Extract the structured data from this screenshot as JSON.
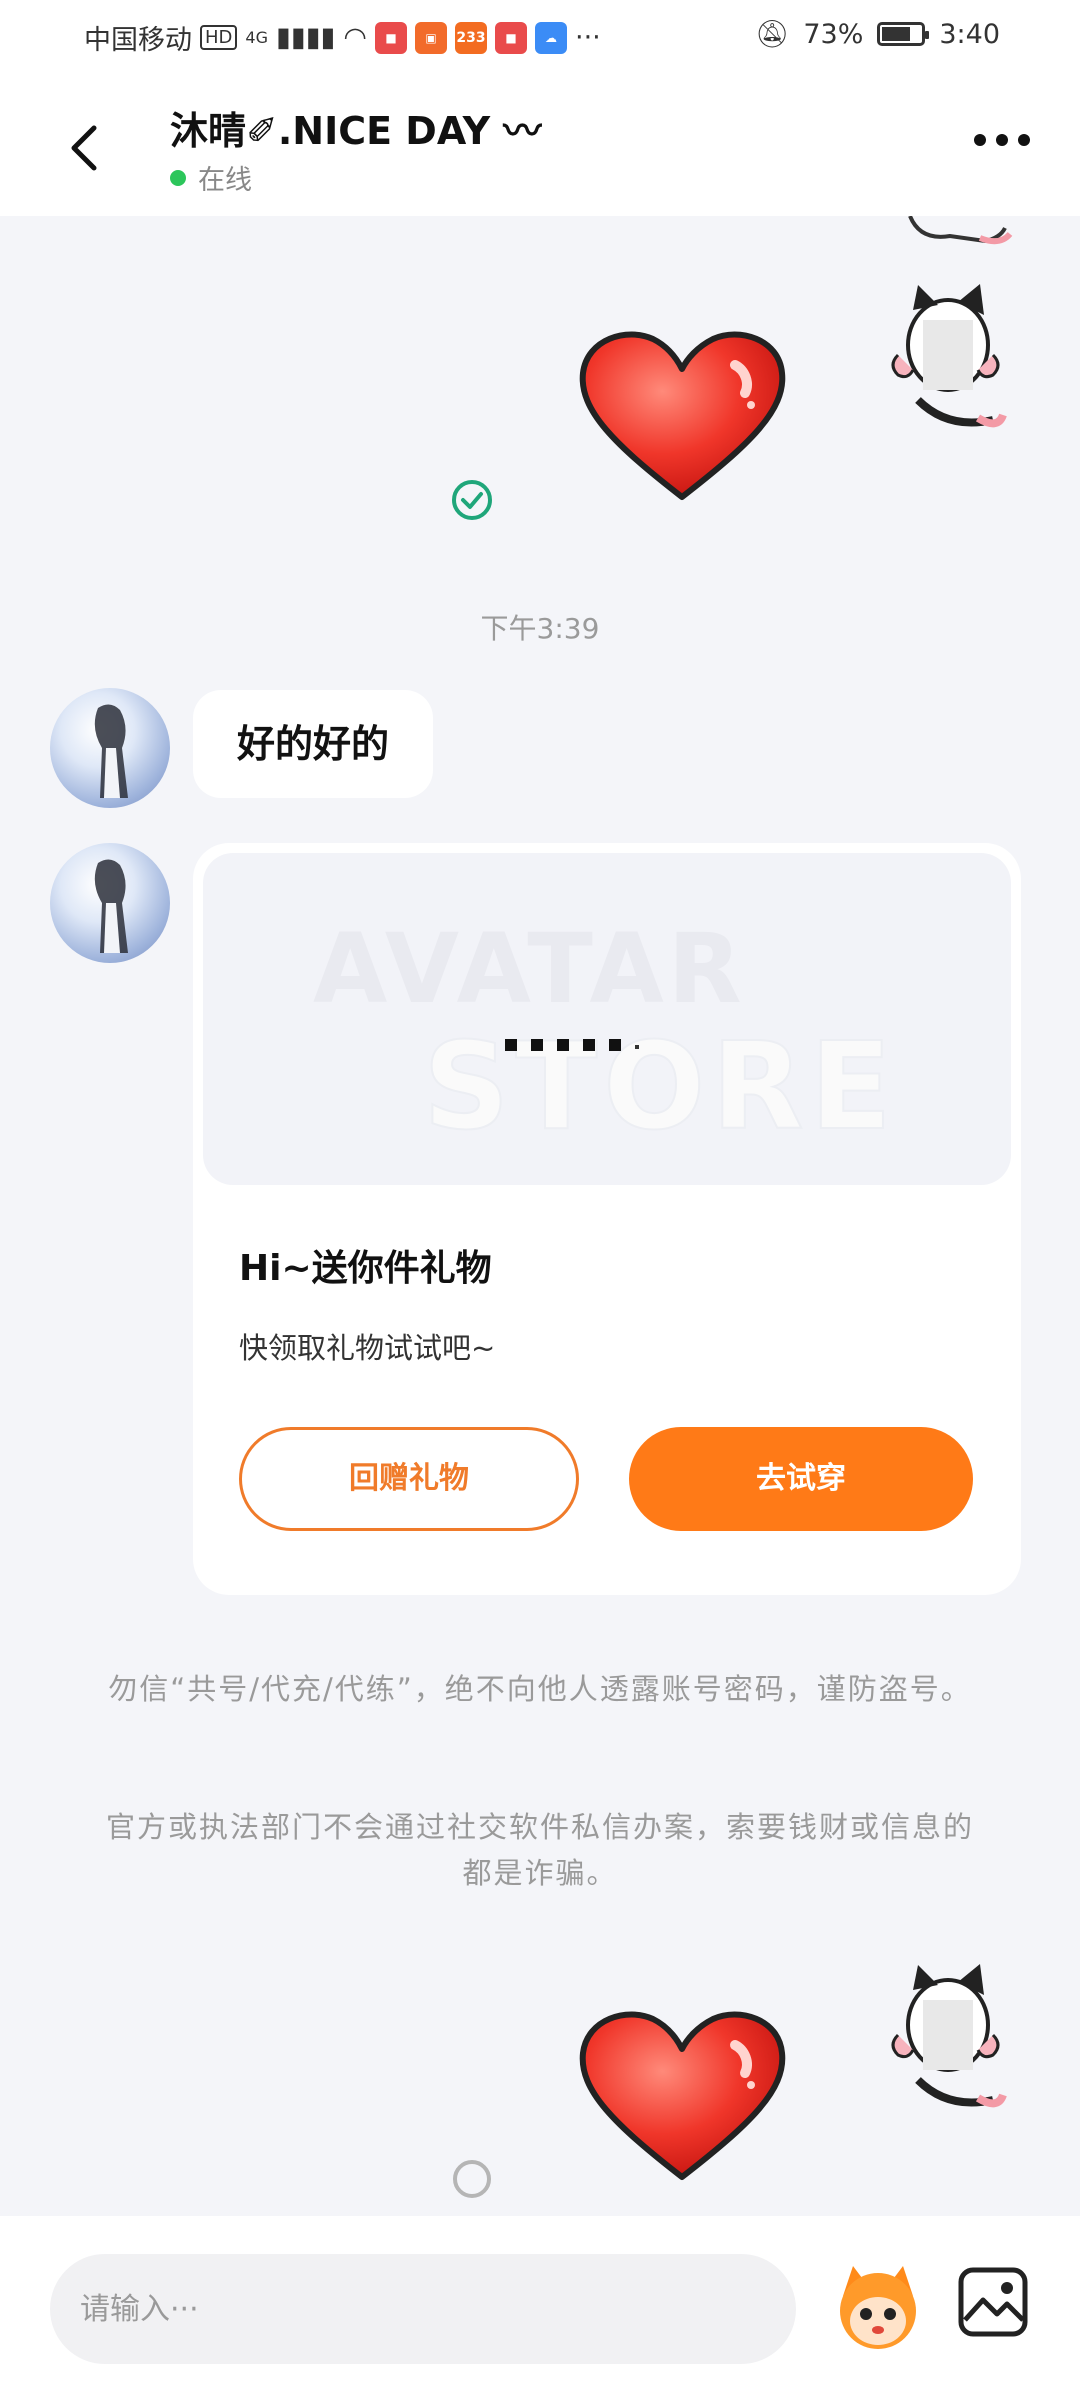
{
  "status_bar": {
    "carrier": "中国移动",
    "net_hd": "HD",
    "net_gen": "4G",
    "app_badge_233": "233",
    "battery_percent": "73%",
    "battery_level": 0.73,
    "time": "3:40",
    "more": "···"
  },
  "header": {
    "title": "沐晴✐.NICE DAY 〰",
    "status": "在线",
    "online_color": "#2cc65b"
  },
  "messages": {
    "time_divider": "下午3:39",
    "text_message": "好的好的"
  },
  "gift_card": {
    "banner_line1": "AVATAR",
    "banner_line2": "STORE",
    "title": "Hi~送你件礼物",
    "subtitle": "快领取礼物试试吧~",
    "return_button": "回赠礼物",
    "try_button": "去试穿",
    "accent_color": "#ff7a17"
  },
  "notices": {
    "line1": "勿信“共号/代充/代练”，绝不向他人透露账号密码，谨防盗号。",
    "line2": "官方或执法部门不会通过社交软件私信办案，索要钱财或信息的都是诈骗。"
  },
  "input_bar": {
    "placeholder": "请输入···"
  },
  "icons": [
    "back-arrow-icon",
    "more-icon",
    "heart-sticker",
    "check-icon",
    "cat-girl-sticker",
    "mascot-icon",
    "image-icon",
    "loading-icon"
  ]
}
